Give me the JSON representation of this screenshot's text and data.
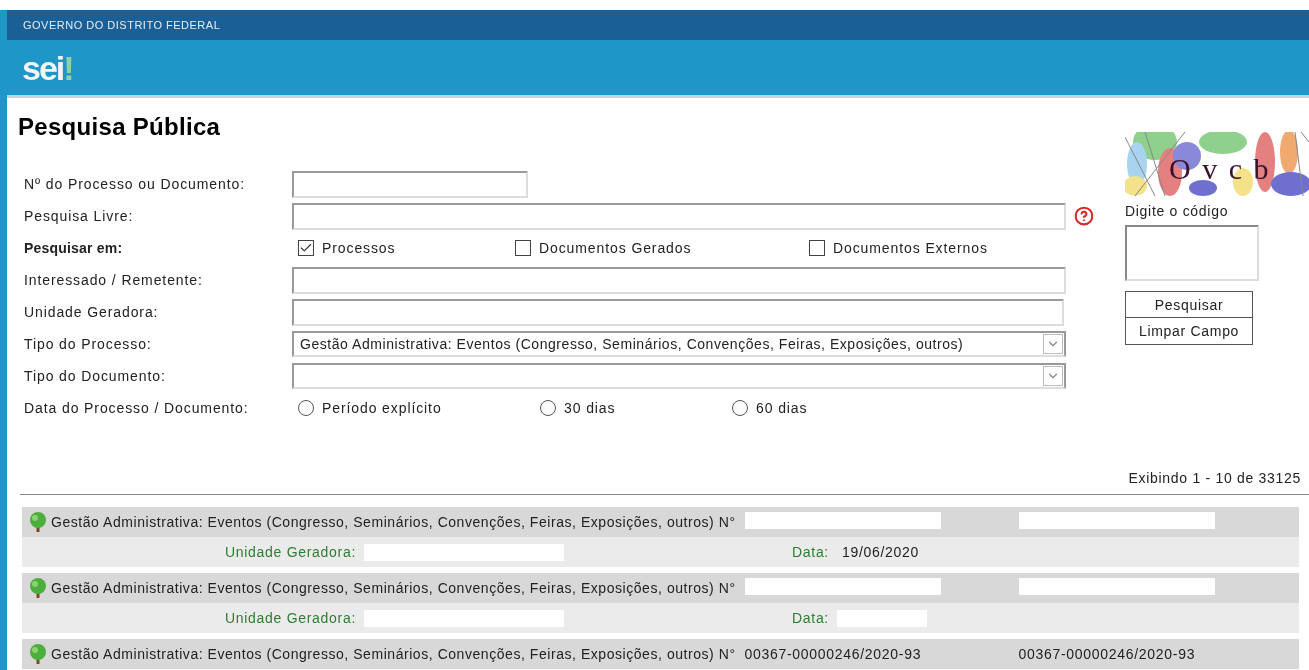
{
  "header": {
    "org": "GOVERNO DO DISTRITO FEDERAL",
    "logo": "sei",
    "logo_mark": "!"
  },
  "page_title": "Pesquisa Pública",
  "form": {
    "process_number": {
      "label": "Nº do Processo ou Documento:"
    },
    "free_search": {
      "label": "Pesquisa Livre:"
    },
    "search_in": {
      "label": "Pesquisar em:",
      "options": [
        {
          "label": "Processos",
          "checked": true
        },
        {
          "label": "Documentos Gerados",
          "checked": false
        },
        {
          "label": "Documentos Externos",
          "checked": false
        }
      ]
    },
    "interested": {
      "label": "Interessado / Remetente:"
    },
    "unit": {
      "label": "Unidade Geradora:"
    },
    "process_type": {
      "label": "Tipo do Processo:",
      "value": "Gestão Administrativa: Eventos (Congresso, Seminários, Convenções, Feiras, Exposições, outros)"
    },
    "document_type": {
      "label": "Tipo do Documento:"
    },
    "date": {
      "label": "Data do Processo / Documento:",
      "options": [
        {
          "label": "Período explícito",
          "selected": false
        },
        {
          "label": "30 dias",
          "selected": false
        },
        {
          "label": "60 dias",
          "selected": false
        }
      ]
    }
  },
  "captcha": {
    "text": "O v c b",
    "prompt": "Digite o código",
    "buttons": [
      "Pesquisar",
      "Limpar Campo"
    ]
  },
  "results": {
    "summary": "Exibindo 1 - 10 de 33125",
    "items": [
      {
        "title": "Gestão Administrativa: Eventos (Congresso, Seminários, Convenções, Feiras, Exposições, outros) N°",
        "number_redacted": true,
        "code_redacted": true,
        "details": {
          "unit_label": "Unidade Geradora:",
          "date_label": "Data:",
          "date": "19/06/2020"
        }
      },
      {
        "title": "Gestão Administrativa: Eventos (Congresso, Seminários, Convenções, Feiras, Exposições, outros) N°",
        "number_redacted": true,
        "code_redacted": true,
        "details": {
          "unit_label": "Unidade Geradora:",
          "date_label": "Data:",
          "date_redacted": true
        }
      },
      {
        "title": "Gestão Administrativa: Eventos (Congresso, Seminários, Convenções, Feiras, Exposições, outros) N°",
        "number": "00367-00000246/2020-93",
        "code": "00367-00000246/2020-93"
      }
    ]
  }
}
